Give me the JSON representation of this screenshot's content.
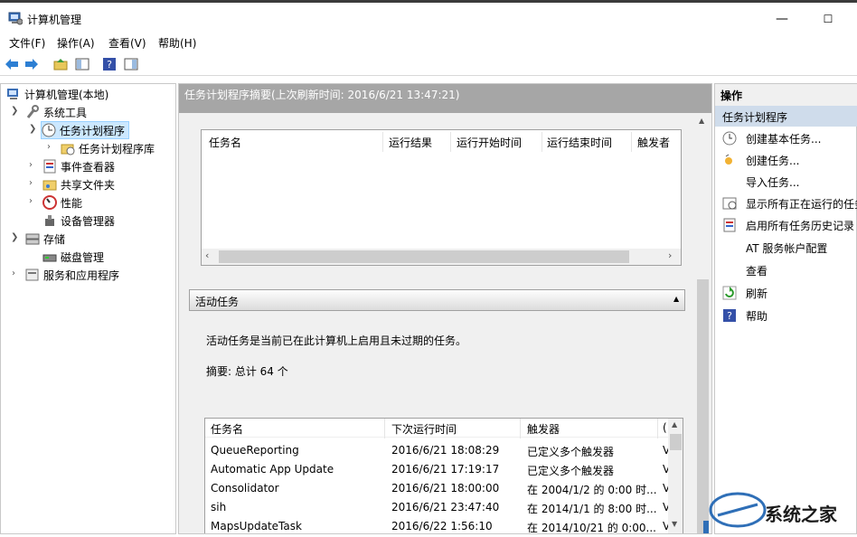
{
  "window": {
    "title": "计算机管理"
  },
  "menu": [
    "文件(F)",
    "操作(A)",
    "查看(V)",
    "帮助(H)"
  ],
  "tree": {
    "root": "计算机管理(本地)",
    "system_tools": "系统工具",
    "task_scheduler": "任务计划程序",
    "task_library": "任务计划程序库",
    "event_viewer": "事件查看器",
    "shared_folders": "共享文件夹",
    "performance": "性能",
    "device_manager": "设备管理器",
    "storage": "存储",
    "disk_management": "磁盘管理",
    "services_apps": "服务和应用程序"
  },
  "center": {
    "summary_header": "任务计划程序摘要(上次刷新时间: 2016/6/21 13:47:21)",
    "table1_headers": [
      "任务名",
      "运行结果",
      "运行开始时间",
      "运行结束时间",
      "触发者"
    ],
    "active_header": "活动任务",
    "active_desc": "活动任务是当前已在此计算机上启用且未过期的任务。",
    "active_summary": "摘要: 总计 64 个",
    "table2_headers": [
      "任务名",
      "下次运行时间",
      "触发器",
      "("
    ],
    "tasks": [
      {
        "name": "QueueReporting",
        "next": "2016/6/21 18:08:29",
        "trigger": "已定义多个触发器",
        "extra": "V"
      },
      {
        "name": "Automatic App Update",
        "next": "2016/6/21 17:19:17",
        "trigger": "已定义多个触发器",
        "extra": "V"
      },
      {
        "name": "Consolidator",
        "next": "2016/6/21 18:00:00",
        "trigger": "在 2004/1/2 的 0:00 时...",
        "extra": "V"
      },
      {
        "name": "sih",
        "next": "2016/6/21 23:47:40",
        "trigger": "在 2014/1/1 的 8:00 时...",
        "extra": "V"
      },
      {
        "name": "MapsUpdateTask",
        "next": "2016/6/22 1:56:10",
        "trigger": "在 2014/10/21 的 0:00...",
        "extra": "V"
      }
    ]
  },
  "actions": {
    "header": "操作",
    "section": "任务计划程序",
    "items": [
      "创建基本任务...",
      "创建任务...",
      "导入任务...",
      "显示所有正在运行的任务",
      "启用所有任务历史记录",
      "AT 服务帐户配置",
      "查看",
      "刷新",
      "帮助"
    ]
  },
  "watermark": {
    "text": "系统之家"
  },
  "colors": {
    "accent": "#3c7fd6",
    "selection": "#cce8ff",
    "header_gray": "#a6a6a6"
  }
}
